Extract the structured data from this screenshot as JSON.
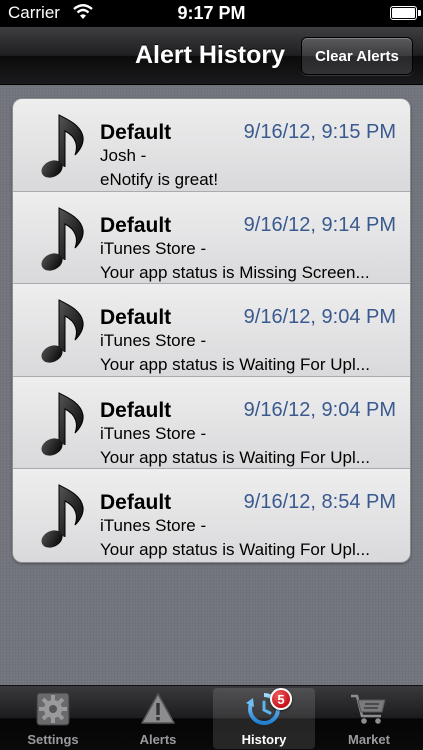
{
  "status_bar": {
    "carrier": "Carrier",
    "time": "9:17 PM"
  },
  "nav": {
    "title": "Alert History",
    "clear_button": "Clear Alerts"
  },
  "alerts": [
    {
      "title": "Default",
      "time": "9/16/12, 9:15 PM",
      "sender": "Josh -",
      "message": "eNotify is great!",
      "icon": "music-note-icon"
    },
    {
      "title": "Default",
      "time": "9/16/12, 9:14 PM",
      "sender": "iTunes Store -",
      "message": "Your app status is Missing Screen...",
      "icon": "music-note-icon"
    },
    {
      "title": "Default",
      "time": "9/16/12, 9:04 PM",
      "sender": "iTunes Store -",
      "message": "Your app status is Waiting For Upl...",
      "icon": "music-note-icon"
    },
    {
      "title": "Default",
      "time": "9/16/12, 9:04 PM",
      "sender": "iTunes Store -",
      "message": "Your app status is Waiting For Upl...",
      "icon": "music-note-icon"
    },
    {
      "title": "Default",
      "time": "9/16/12, 8:54 PM",
      "sender": "iTunes Store -",
      "message": "Your app status is Waiting For Upl...",
      "icon": "music-note-icon"
    }
  ],
  "tabs": [
    {
      "label": "Settings",
      "icon": "gear-icon",
      "active": false
    },
    {
      "label": "Alerts",
      "icon": "warning-icon",
      "active": false
    },
    {
      "label": "History",
      "icon": "history-icon",
      "active": true,
      "badge": "5"
    },
    {
      "label": "Market",
      "icon": "cart-icon",
      "active": false
    }
  ],
  "colors": {
    "timestamp": "#3a5a8f",
    "badge": "#c8101a"
  }
}
